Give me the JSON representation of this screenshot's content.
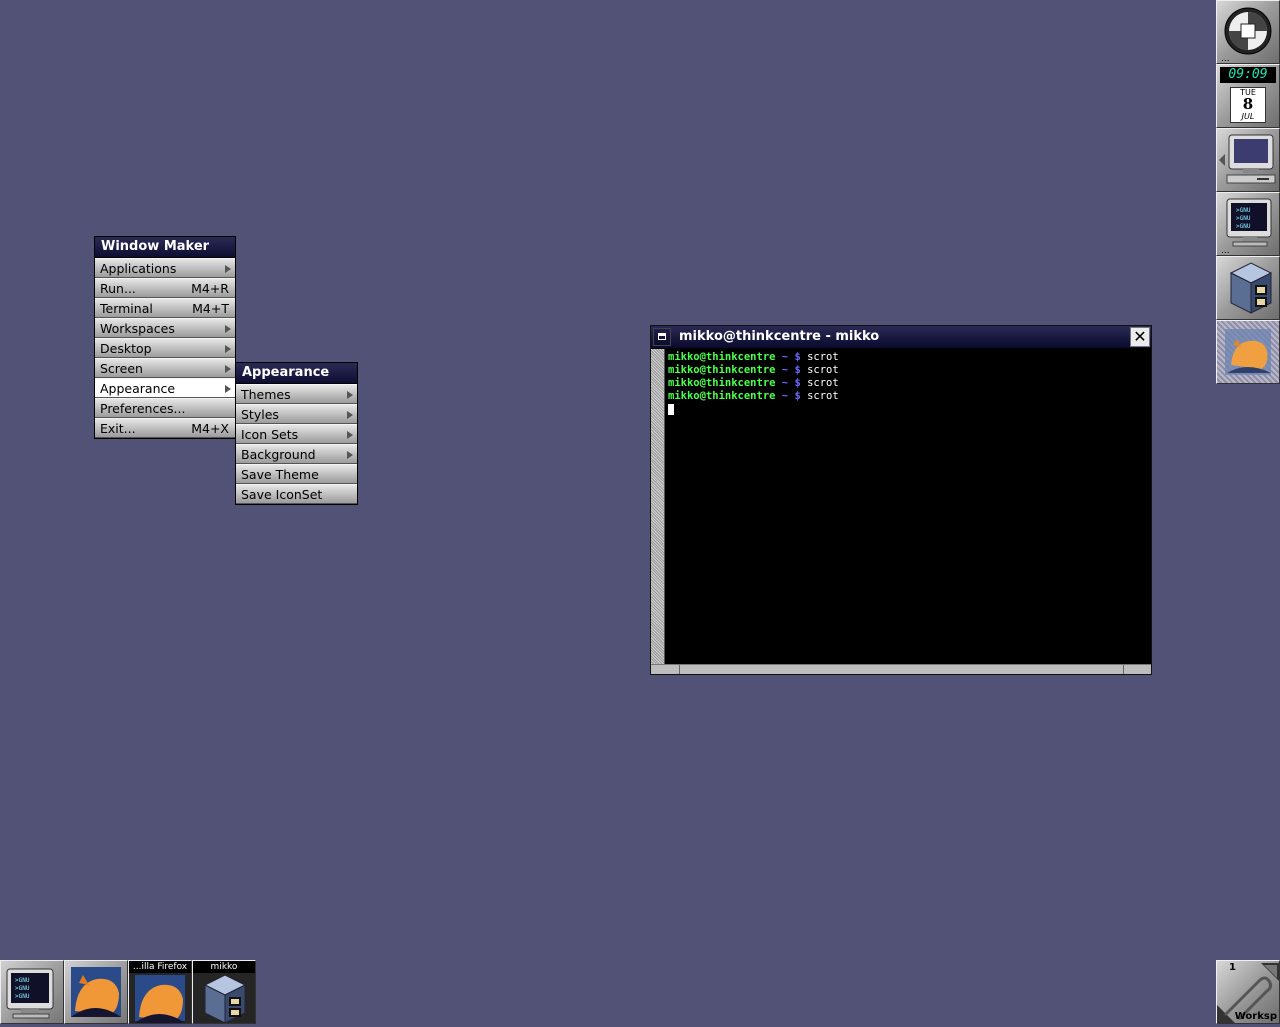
{
  "root_menu": {
    "title": "Window Maker",
    "items": [
      {
        "label": "Applications",
        "shortcut": "",
        "submenu": true
      },
      {
        "label": "Run...",
        "shortcut": "M4+R",
        "submenu": false
      },
      {
        "label": "Terminal",
        "shortcut": "M4+T",
        "submenu": false
      },
      {
        "label": "Workspaces",
        "shortcut": "",
        "submenu": true
      },
      {
        "label": "Desktop",
        "shortcut": "",
        "submenu": true
      },
      {
        "label": "Screen",
        "shortcut": "",
        "submenu": true
      },
      {
        "label": "Appearance",
        "shortcut": "",
        "submenu": true,
        "selected": true
      },
      {
        "label": "Preferences...",
        "shortcut": "",
        "submenu": false
      },
      {
        "label": "Exit...",
        "shortcut": "M4+X",
        "submenu": false
      }
    ]
  },
  "appearance_menu": {
    "title": "Appearance",
    "items": [
      {
        "label": "Themes",
        "submenu": true
      },
      {
        "label": "Styles",
        "submenu": true
      },
      {
        "label": "Icon Sets",
        "submenu": true
      },
      {
        "label": "Background",
        "submenu": true
      },
      {
        "label": "Save Theme",
        "submenu": false
      },
      {
        "label": "Save IconSet",
        "submenu": false
      }
    ]
  },
  "terminal": {
    "title": "mikko@thinkcentre - mikko",
    "close_glyph": "✕",
    "lines": [
      {
        "user": "mikko@thinkcentre",
        "tilde": "~ $",
        "cmd": "scrot"
      },
      {
        "user": "mikko@thinkcentre",
        "tilde": "~ $",
        "cmd": "scrot"
      },
      {
        "user": "mikko@thinkcentre",
        "tilde": "~ $",
        "cmd": "scrot"
      },
      {
        "user": "mikko@thinkcentre",
        "tilde": "~ $",
        "cmd": "scrot"
      }
    ]
  },
  "dock": {
    "clock_time": "09:09",
    "day": "TUE",
    "date": "8",
    "month": "JUL",
    "ellipsis": "...",
    "gnu_text": ">GNU"
  },
  "taskbar": {
    "firefox_label": "...illa Firefox",
    "files_label": "mikko",
    "gnu_text": ">GNU"
  },
  "workspace_clip": {
    "number": "1",
    "label": "Worksp"
  },
  "colors": {
    "desktop": "#525276",
    "title_bar": "#0e0e33",
    "prompt_user": "#4dff4d",
    "prompt_tilde": "#6a6aff"
  }
}
